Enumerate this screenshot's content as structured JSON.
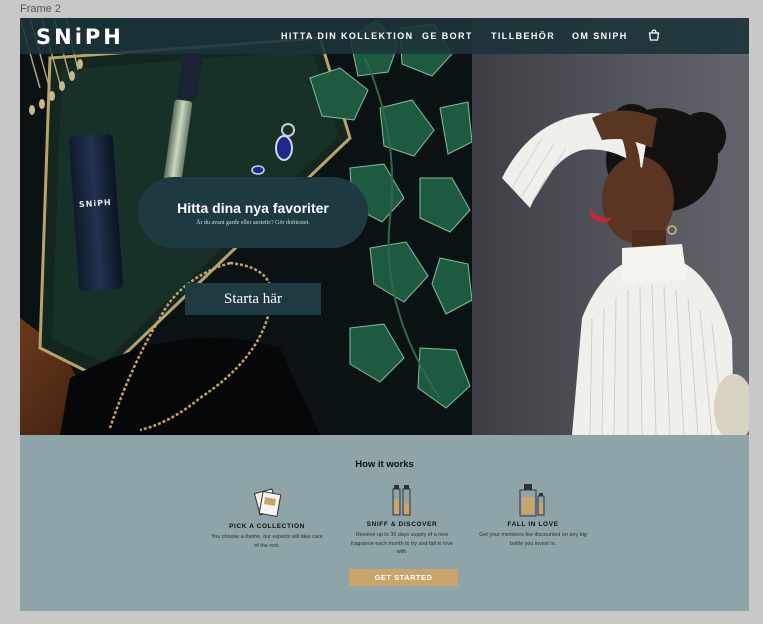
{
  "frame_label": "Frame 2",
  "brand": {
    "logo": "SNiPH",
    "bottle_logo": "SNiPH"
  },
  "nav": {
    "items": [
      {
        "label": "HITTA DIN KOLLEKTION"
      },
      {
        "label": "GE BORT"
      },
      {
        "label": "TILLBEHÖR"
      },
      {
        "label": "OM SNIPH"
      }
    ],
    "cart_icon": "shopping-bag-icon"
  },
  "hero": {
    "title": "Hitta dina nya favoriter",
    "subtitle": "Är du avant garde eller aestetic? Gör dofttestet.",
    "button_label": "Starta här"
  },
  "how_it_works": {
    "title": "How it works",
    "steps": [
      {
        "title": "PICK A COLLECTION",
        "desc": "You choose a theme, our experts will take care of the rest.",
        "icon": "collection-cards-icon"
      },
      {
        "title": "SNIFF & DISCOVER",
        "desc": "Receive up to 30 days supply of a new fragrance each month to try and fall in love with.",
        "icon": "perfume-vials-icon"
      },
      {
        "title": "FALL IN LOVE",
        "desc": "Get your members fee discounted on any big bottle you invest in.",
        "icon": "perfume-bottle-icon"
      }
    ],
    "cta_label": "GET STARTED"
  },
  "colors": {
    "nav_bg": "#1c343a",
    "hero_card": "#1d3a40",
    "section_bg": "#8ea4a8",
    "cta": "#c9a46b"
  }
}
